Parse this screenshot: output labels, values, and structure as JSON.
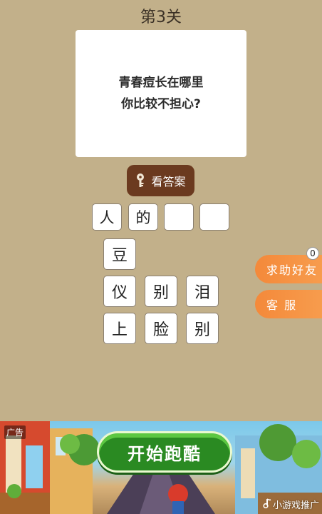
{
  "level": {
    "title": "第3关"
  },
  "question": {
    "lines": [
      "青春痘长在哪里",
      "你比较不担心?"
    ]
  },
  "answer_button": {
    "label": "看答案",
    "icon": "key-icon"
  },
  "answer_slots": [
    "人",
    "的",
    "",
    ""
  ],
  "choices": {
    "row1": [
      "豆"
    ],
    "row2": [
      "仪",
      "别",
      "泪"
    ],
    "row3": [
      "上",
      "脸",
      "别"
    ]
  },
  "side_buttons": {
    "help": {
      "label": "求助好友",
      "badge": "0"
    },
    "service": {
      "label": "客 服"
    }
  },
  "ad": {
    "tag": "广告",
    "cta": "开始跑酷",
    "promo": "小游戏推广"
  },
  "colors": {
    "background": "#c2b08a",
    "answer_button": "#6b3a1f",
    "side_button": "#f4893a",
    "ad_cta": "#2a8a22"
  }
}
